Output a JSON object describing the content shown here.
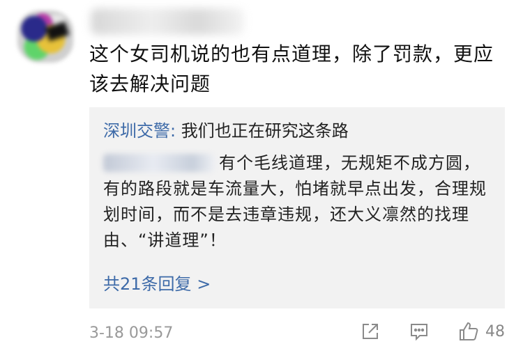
{
  "comment": {
    "text": "这个女司机说的也有点道理，除了罚款，更应该去解决问题",
    "timestamp": "3-18 09:57",
    "likes": "48"
  },
  "reply": {
    "author": "深圳交警",
    "author_suffix": ":",
    "text": " 我们也正在研究这条路",
    "body": "有个毛线道理，无规矩不成方圆，有的路段就是车流量大，怕堵就早点出发，合理规划时间，而不是去违章违规，还大义凛然的找理由、“讲道理”！",
    "more_label": "共21条回复",
    "more_chevron": ">"
  },
  "icons": {
    "share": "share-icon",
    "comment": "comment-icon",
    "like": "thumbs-up-icon"
  },
  "colors": {
    "link": "#3d6aa8",
    "muted": "#999999",
    "reply_bg": "#f2f2f2"
  }
}
